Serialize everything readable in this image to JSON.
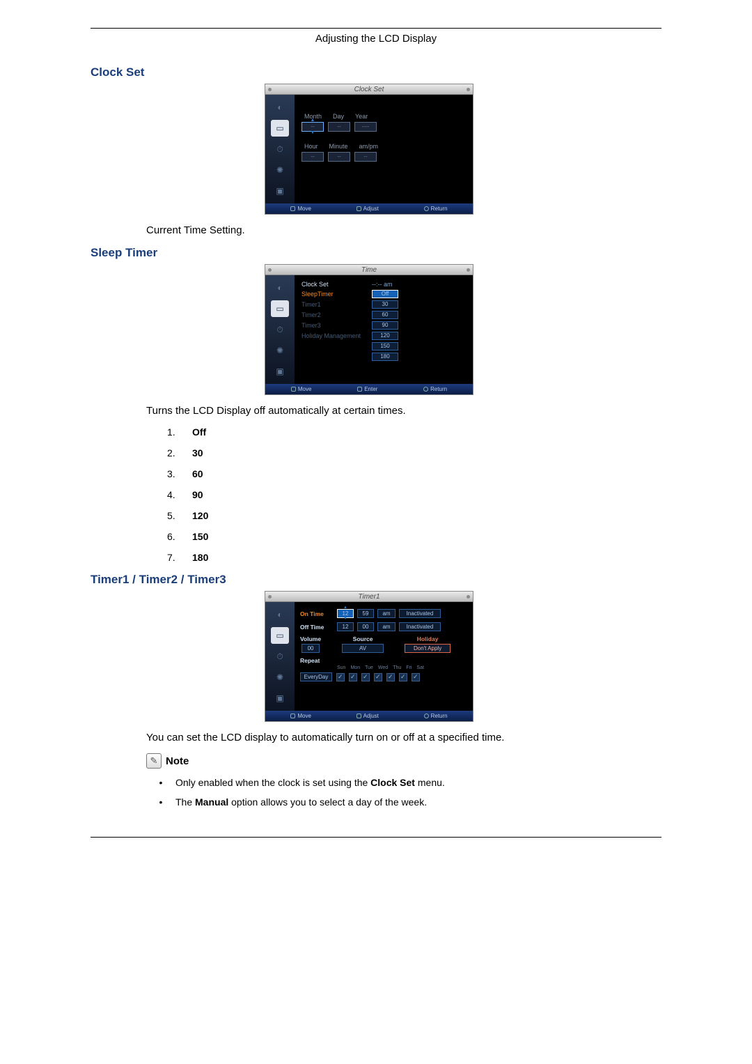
{
  "header": {
    "title": "Adjusting the LCD Display"
  },
  "clock_set": {
    "heading": "Clock Set",
    "desc": "Current Time Setting.",
    "osd": {
      "title": "Clock Set",
      "labels_row1": [
        "Month",
        "Day",
        "Year"
      ],
      "values_row1": [
        "--",
        "--",
        "----"
      ],
      "labels_row2": [
        "Hour",
        "Minute",
        "am/pm"
      ],
      "values_row2": [
        "--",
        "--",
        "--"
      ],
      "footer": {
        "move": "Move",
        "adjust": "Adjust",
        "return": "Return"
      }
    }
  },
  "sleep_timer": {
    "heading": "Sleep Timer",
    "desc": "Turns the LCD Display off automatically at certain times.",
    "options": [
      "Off",
      "30",
      "60",
      "90",
      "120",
      "150",
      "180"
    ],
    "osd": {
      "title": "Time",
      "rows": [
        {
          "label": "Clock Set",
          "value": "--:-- am",
          "style": "plain"
        },
        {
          "label": "SleepTimer",
          "value": "Off",
          "style": "selected"
        },
        {
          "label": "Timer1",
          "value": "30",
          "style": "dim"
        },
        {
          "label": "Timer2",
          "value": "60",
          "style": "dim"
        },
        {
          "label": "Timer3",
          "value": "90",
          "style": "dim"
        },
        {
          "label": "Holiday Management",
          "value": "120",
          "style": "dim"
        }
      ],
      "extra_chips": [
        "150",
        "180"
      ],
      "footer": {
        "move": "Move",
        "enter": "Enter",
        "return": "Return"
      }
    }
  },
  "timers": {
    "heading": "Timer1 / Timer2 / Timer3",
    "desc": "You can set the LCD display to automatically turn on or off at a specified time.",
    "note_label": "Note",
    "notes": [
      "Only enabled when the clock is set using the Clock Set menu.",
      "The Manual option allows you to select a day of the week."
    ],
    "notes_bold": {
      "0": "Clock Set",
      "1": "Manual"
    },
    "osd": {
      "title": "Timer1",
      "on_time": {
        "label": "On Time",
        "h": "12",
        "m": "59",
        "ampm": "am",
        "state": "Inactivated"
      },
      "off_time": {
        "label": "Off Time",
        "h": "12",
        "m": "00",
        "ampm": "am",
        "state": "Inactivated"
      },
      "volume": {
        "label": "Volume",
        "value": "00"
      },
      "source": {
        "label": "Source",
        "value": "AV"
      },
      "holiday": {
        "label": "Holiday",
        "value": "Don't Apply"
      },
      "repeat": {
        "label": "Repeat",
        "value": "EveryDay"
      },
      "days": [
        "Sun",
        "Mon",
        "Tue",
        "Wed",
        "Thu",
        "Fri",
        "Sat"
      ],
      "footer": {
        "move": "Move",
        "adjust": "Adjust",
        "return": "Return"
      }
    }
  },
  "icons": {
    "side": [
      "◐",
      "▭",
      "⏱",
      "✺",
      "▣"
    ]
  }
}
